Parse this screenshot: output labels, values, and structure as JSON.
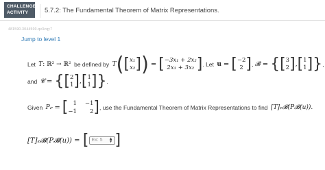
{
  "header": {
    "badge_line1": "CHALLENGE",
    "badge_line2": "ACTIVITY",
    "title": "5.7.2: The Fundamental Theorem of Matrix Representations."
  },
  "activity_id": "481590.3044500.qx3zqy7",
  "jump_link": "Jump to level 1",
  "problem": {
    "let_text": "Let",
    "T": "T",
    "map": ": ℝ² → ℝ²",
    "defined_text": "be defined by",
    "input_vec": [
      "x₁",
      "x₂"
    ],
    "output_vec": [
      "−3x₁ + 2x₂",
      "2x₁ + 3x₂"
    ],
    "let_u_text": "Let",
    "u_label": "u",
    "u_vec": [
      "−2",
      "2"
    ],
    "B_label": "𝓑",
    "B_vecs": [
      [
        "3",
        "2"
      ],
      [
        "1",
        "1"
      ]
    ],
    "and_text": "and",
    "C_label": "𝓒",
    "C_vecs": [
      [
        "2",
        "1"
      ],
      [
        "1",
        "1"
      ]
    ],
    "given_text": "Given",
    "P_label": "P𝒸",
    "P_matrix": [
      [
        "1",
        "−1"
      ],
      [
        "−1",
        "2"
      ]
    ],
    "instruction": ", use the Fundamental Theorem of Matrix Representations to find",
    "target_expr": "[T]𝒸𝓑(P𝓑(u))."
  },
  "answer": {
    "lhs": "[T]𝒸𝓑(P𝓑(u)) =",
    "input_placeholder": "Ex: 5"
  }
}
